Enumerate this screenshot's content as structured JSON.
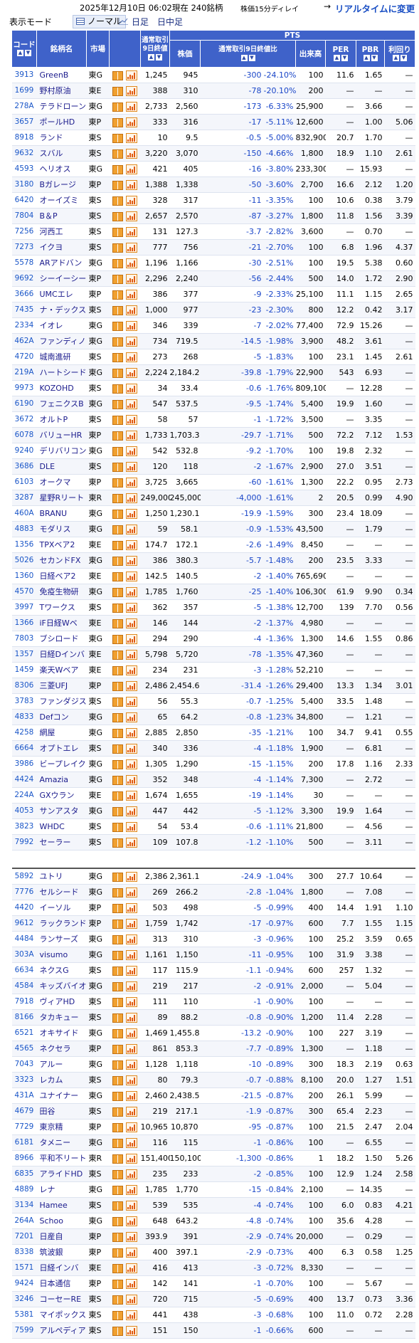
{
  "header": {
    "timestamp": "2025年12月10日  06:02現在  240銘柄",
    "delay_note": "株価15分ディレイ",
    "arrow": "→",
    "realtime_link": "リアルタイムに変更",
    "mode_label": "表示モード",
    "mode_normal": "ノーマル",
    "mode_day": "日足",
    "mode_day_mid": "日中足"
  },
  "table": {
    "headers": {
      "code": "コード",
      "name": "銘柄名",
      "market": "市場",
      "close_group": "通常取引9日終値",
      "pts": "PTS",
      "price": "株価",
      "change": "通常取引9日終値比",
      "volume": "出来高",
      "per": "PER",
      "pbr": "PBR",
      "yield": "利回り"
    },
    "rows": [
      [
        "3913",
        "GreenB",
        "東G",
        "1,245",
        "945",
        "-300",
        "-24.10%",
        "100",
        "11.6",
        "1.65",
        "—"
      ],
      [
        "1699",
        "野村原油",
        "東E",
        "388",
        "310",
        "-78",
        "-20.10%",
        "200",
        "—",
        "—",
        "—"
      ],
      [
        "278A",
        "テラドローン",
        "東G",
        "2,733",
        "2,560",
        "-173",
        "-6.33%",
        "25,900",
        "—",
        "3.66",
        "—"
      ],
      [
        "3657",
        "ポールHD",
        "東P",
        "333",
        "316",
        "-17",
        "-5.11%",
        "12,600",
        "—",
        "1.00",
        "5.06"
      ],
      [
        "8918",
        "ランド",
        "東S",
        "10",
        "9.5",
        "-0.5",
        "-5.00%",
        "832,900",
        "20.7",
        "1.70",
        "—"
      ],
      [
        "9632",
        "スバル",
        "東S",
        "3,220",
        "3,070",
        "-150",
        "-4.66%",
        "1,800",
        "18.9",
        "1.10",
        "2.61"
      ],
      [
        "4593",
        "ヘリオス",
        "東G",
        "421",
        "405",
        "-16",
        "-3.80%",
        "233,300",
        "—",
        "15.93",
        "—"
      ],
      [
        "3180",
        "Bガレージ",
        "東P",
        "1,388",
        "1,338",
        "-50",
        "-3.60%",
        "2,700",
        "16.6",
        "2.12",
        "1.20"
      ],
      [
        "6420",
        "オーイズミ",
        "東S",
        "328",
        "317",
        "-11",
        "-3.35%",
        "100",
        "10.6",
        "0.38",
        "3.79"
      ],
      [
        "7804",
        "B＆P",
        "東S",
        "2,657",
        "2,570",
        "-87",
        "-3.27%",
        "1,800",
        "11.8",
        "1.56",
        "3.39"
      ],
      [
        "7256",
        "河西工",
        "東S",
        "131",
        "127.3",
        "-3.7",
        "-2.82%",
        "3,600",
        "—",
        "0.70",
        "—"
      ],
      [
        "7273",
        "イクヨ",
        "東S",
        "777",
        "756",
        "-21",
        "-2.70%",
        "100",
        "6.8",
        "1.96",
        "4.37"
      ],
      [
        "5578",
        "ARアドバン",
        "東G",
        "1,196",
        "1,166",
        "-30",
        "-2.51%",
        "100",
        "19.5",
        "5.38",
        "0.60"
      ],
      [
        "9692",
        "シーイーシー",
        "東P",
        "2,296",
        "2,240",
        "-56",
        "-2.44%",
        "500",
        "14.0",
        "1.72",
        "2.90"
      ],
      [
        "3666",
        "UMCエレ",
        "東P",
        "386",
        "377",
        "-9",
        "-2.33%",
        "25,100",
        "11.1",
        "1.15",
        "2.65"
      ],
      [
        "7435",
        "ナ・デックス",
        "東S",
        "1,000",
        "977",
        "-23",
        "-2.30%",
        "800",
        "12.2",
        "0.42",
        "3.17"
      ],
      [
        "2334",
        "イオレ",
        "東G",
        "346",
        "339",
        "-7",
        "-2.02%",
        "77,400",
        "72.9",
        "15.26",
        "—"
      ],
      [
        "462A",
        "ファンディノ",
        "東G",
        "734",
        "719.5",
        "-14.5",
        "-1.98%",
        "3,900",
        "48.2",
        "3.61",
        "—"
      ],
      [
        "4720",
        "城南進研",
        "東S",
        "273",
        "268",
        "-5",
        "-1.83%",
        "100",
        "23.1",
        "1.45",
        "2.61"
      ],
      [
        "219A",
        "ハートシード",
        "東G",
        "2,224",
        "2,184.2",
        "-39.8",
        "-1.79%",
        "22,900",
        "543",
        "6.93",
        "—"
      ],
      [
        "9973",
        "KOZOHD",
        "東S",
        "34",
        "33.4",
        "-0.6",
        "-1.76%",
        "809,100",
        "—",
        "12.28",
        "—"
      ],
      [
        "6190",
        "フェニクスB",
        "東G",
        "547",
        "537.5",
        "-9.5",
        "-1.74%",
        "5,400",
        "19.9",
        "1.60",
        "—"
      ],
      [
        "3672",
        "オルトP",
        "東S",
        "58",
        "57",
        "-1",
        "-1.72%",
        "3,500",
        "—",
        "3.35",
        "—"
      ],
      [
        "6078",
        "バリューHR",
        "東P",
        "1,733",
        "1,703.3",
        "-29.7",
        "-1.71%",
        "500",
        "72.2",
        "7.12",
        "1.53"
      ],
      [
        "9240",
        "デリバリコン",
        "東G",
        "542",
        "532.8",
        "-9.2",
        "-1.70%",
        "100",
        "19.8",
        "2.32",
        "—"
      ],
      [
        "3686",
        "DLE",
        "東S",
        "120",
        "118",
        "-2",
        "-1.67%",
        "2,900",
        "27.0",
        "3.51",
        "—"
      ],
      [
        "6103",
        "オークマ",
        "東P",
        "3,725",
        "3,665",
        "-60",
        "-1.61%",
        "1,300",
        "22.2",
        "0.95",
        "2.73"
      ],
      [
        "3287",
        "星野Rリート",
        "東R",
        "249,000",
        "245,000",
        "-4,000",
        "-1.61%",
        "2",
        "20.5",
        "0.99",
        "4.90"
      ],
      [
        "460A",
        "BRANU",
        "東G",
        "1,250",
        "1,230.1",
        "-19.9",
        "-1.59%",
        "300",
        "23.4",
        "18.09",
        "—"
      ],
      [
        "4883",
        "モダリス",
        "東G",
        "59",
        "58.1",
        "-0.9",
        "-1.53%",
        "43,500",
        "—",
        "1.79",
        "—"
      ],
      [
        "1356",
        "TPXベア2",
        "東E",
        "174.7",
        "172.1",
        "-2.6",
        "-1.49%",
        "8,450",
        "—",
        "—",
        "—"
      ],
      [
        "5026",
        "セカンドFX",
        "東G",
        "386",
        "380.3",
        "-5.7",
        "-1.48%",
        "200",
        "23.5",
        "3.33",
        "—"
      ],
      [
        "1360",
        "日経ベア2",
        "東E",
        "142.5",
        "140.5",
        "-2",
        "-1.40%",
        "765,690",
        "—",
        "—",
        "—"
      ],
      [
        "4570",
        "免疫生物研",
        "東G",
        "1,785",
        "1,760",
        "-25",
        "-1.40%",
        "106,300",
        "61.9",
        "9.90",
        "0.34"
      ],
      [
        "3997",
        "Tワークス",
        "東S",
        "362",
        "357",
        "-5",
        "-1.38%",
        "12,700",
        "139",
        "7.70",
        "0.56"
      ],
      [
        "1366",
        "iF日経Wベ",
        "東E",
        "146",
        "144",
        "-2",
        "-1.37%",
        "4,980",
        "—",
        "—",
        "—"
      ],
      [
        "7803",
        "ブシロード",
        "東G",
        "294",
        "290",
        "-4",
        "-1.36%",
        "1,300",
        "14.6",
        "1.55",
        "0.86"
      ],
      [
        "1357",
        "日経Dインバ",
        "東E",
        "5,798",
        "5,720",
        "-78",
        "-1.35%",
        "47,360",
        "—",
        "—",
        "—"
      ],
      [
        "1459",
        "楽天Wベア",
        "東E",
        "234",
        "231",
        "-3",
        "-1.28%",
        "52,210",
        "—",
        "—",
        "—"
      ],
      [
        "8306",
        "三菱UFJ",
        "東P",
        "2,486",
        "2,454.6",
        "-31.4",
        "-1.26%",
        "29,400",
        "13.3",
        "1.34",
        "3.01"
      ],
      [
        "3783",
        "ファンダジス",
        "東S",
        "56",
        "55.3",
        "-0.7",
        "-1.25%",
        "5,400",
        "33.5",
        "1.48",
        "—"
      ],
      [
        "4833",
        "Defコン",
        "東G",
        "65",
        "64.2",
        "-0.8",
        "-1.23%",
        "34,800",
        "—",
        "1.21",
        "—"
      ],
      [
        "4258",
        "網屋",
        "東G",
        "2,885",
        "2,850",
        "-35",
        "-1.21%",
        "100",
        "34.7",
        "9.41",
        "0.55"
      ],
      [
        "6664",
        "オプトエレ",
        "東S",
        "340",
        "336",
        "-4",
        "-1.18%",
        "1,900",
        "—",
        "6.81",
        "—"
      ],
      [
        "3986",
        "ビープレイク",
        "東G",
        "1,305",
        "1,290",
        "-15",
        "-1.15%",
        "200",
        "17.8",
        "1.16",
        "2.33"
      ],
      [
        "4424",
        "Amazia",
        "東G",
        "352",
        "348",
        "-4",
        "-1.14%",
        "7,300",
        "—",
        "2.72",
        "—"
      ],
      [
        "224A",
        "GXウラン",
        "東E",
        "1,674",
        "1,655",
        "-19",
        "-1.14%",
        "30",
        "—",
        "—",
        "—"
      ],
      [
        "4053",
        "サンアスタ",
        "東G",
        "447",
        "442",
        "-5",
        "-1.12%",
        "3,300",
        "19.9",
        "1.64",
        "—"
      ],
      [
        "3823",
        "WHDC",
        "東S",
        "54",
        "53.4",
        "-0.6",
        "-1.11%",
        "21,800",
        "—",
        "4.56",
        "—"
      ],
      [
        "7992",
        "セーラー",
        "東S",
        "109",
        "107.8",
        "-1.2",
        "-1.10%",
        "500",
        "—",
        "3.11",
        "—"
      ]
    ],
    "rows2": [
      [
        "5892",
        "ユトリ",
        "東G",
        "2,386",
        "2,361.1",
        "-24.9",
        "-1.04%",
        "300",
        "27.7",
        "10.64",
        "—"
      ],
      [
        "7776",
        "セルシード",
        "東G",
        "269",
        "266.2",
        "-2.8",
        "-1.04%",
        "1,800",
        "—",
        "7.08",
        "—"
      ],
      [
        "4420",
        "イーソル",
        "東P",
        "503",
        "498",
        "-5",
        "-0.99%",
        "400",
        "14.4",
        "1.91",
        "1.10"
      ],
      [
        "9612",
        "ラックランド",
        "東P",
        "1,759",
        "1,742",
        "-17",
        "-0.97%",
        "600",
        "7.7",
        "1.55",
        "1.15"
      ],
      [
        "4484",
        "ランサーズ",
        "東G",
        "313",
        "310",
        "-3",
        "-0.96%",
        "100",
        "25.2",
        "3.59",
        "0.65"
      ],
      [
        "303A",
        "visumo",
        "東G",
        "1,161",
        "1,150",
        "-11",
        "-0.95%",
        "100",
        "31.9",
        "3.38",
        "—"
      ],
      [
        "6634",
        "ネクスG",
        "東S",
        "117",
        "115.9",
        "-1.1",
        "-0.94%",
        "600",
        "257",
        "1.32",
        "—"
      ],
      [
        "4584",
        "キッズバイオ",
        "東G",
        "219",
        "217",
        "-2",
        "-0.91%",
        "2,000",
        "—",
        "5.04",
        "—"
      ],
      [
        "7918",
        "ヴィアHD",
        "東S",
        "111",
        "110",
        "-1",
        "-0.90%",
        "100",
        "—",
        "—",
        "—"
      ],
      [
        "8166",
        "タカキュー",
        "東S",
        "89",
        "88.2",
        "-0.8",
        "-0.90%",
        "1,200",
        "11.4",
        "2.28",
        "—"
      ],
      [
        "6521",
        "オキサイド",
        "東G",
        "1,469",
        "1,455.8",
        "-13.2",
        "-0.90%",
        "100",
        "227",
        "3.19",
        "—"
      ],
      [
        "4565",
        "ネクセラ",
        "東P",
        "861",
        "853.3",
        "-7.7",
        "-0.89%",
        "1,300",
        "—",
        "1.18",
        "—"
      ],
      [
        "7043",
        "アルー",
        "東G",
        "1,128",
        "1,118",
        "-10",
        "-0.89%",
        "300",
        "18.3",
        "2.19",
        "0.63"
      ],
      [
        "3323",
        "レカム",
        "東S",
        "80",
        "79.3",
        "-0.7",
        "-0.88%",
        "8,100",
        "20.0",
        "1.27",
        "1.51"
      ],
      [
        "431A",
        "ユナイナー",
        "東G",
        "2,460",
        "2,438.5",
        "-21.5",
        "-0.87%",
        "200",
        "26.1",
        "5.99",
        "—"
      ],
      [
        "4679",
        "田谷",
        "東S",
        "219",
        "217.1",
        "-1.9",
        "-0.87%",
        "300",
        "65.4",
        "2.23",
        "—"
      ],
      [
        "7729",
        "東京精",
        "東P",
        "10,965",
        "10,870",
        "-95",
        "-0.87%",
        "100",
        "21.5",
        "2.47",
        "2.04"
      ],
      [
        "6181",
        "タメニー",
        "東G",
        "116",
        "115",
        "-1",
        "-0.86%",
        "100",
        "—",
        "6.55",
        "—"
      ],
      [
        "8966",
        "平和不リート",
        "東R",
        "151,400",
        "150,100",
        "-1,300",
        "-0.86%",
        "1",
        "18.2",
        "1.50",
        "5.26"
      ],
      [
        "6835",
        "アライドHD",
        "東S",
        "235",
        "233",
        "-2",
        "-0.85%",
        "100",
        "12.9",
        "1.24",
        "2.58"
      ],
      [
        "4889",
        "レナ",
        "東G",
        "1,785",
        "1,770",
        "-15",
        "-0.84%",
        "2,100",
        "—",
        "14.35",
        "—"
      ],
      [
        "3134",
        "Hamee",
        "東S",
        "539",
        "535",
        "-4",
        "-0.74%",
        "100",
        "6.0",
        "0.83",
        "4.21"
      ],
      [
        "264A",
        "Schoo",
        "東G",
        "648",
        "643.2",
        "-4.8",
        "-0.74%",
        "100",
        "35.6",
        "4.28",
        "—"
      ],
      [
        "7201",
        "日産自",
        "東P",
        "393.9",
        "391",
        "-2.9",
        "-0.74%",
        "20,000",
        "—",
        "0.29",
        "—"
      ],
      [
        "8338",
        "筑波銀",
        "東P",
        "400",
        "397.1",
        "-2.9",
        "-0.73%",
        "400",
        "6.3",
        "0.58",
        "1.25"
      ],
      [
        "1571",
        "日経インバ",
        "東E",
        "416",
        "413",
        "-3",
        "-0.72%",
        "8,330",
        "—",
        "—",
        "—"
      ],
      [
        "9424",
        "日本通信",
        "東P",
        "142",
        "141",
        "-1",
        "-0.70%",
        "100",
        "—",
        "5.67",
        "—"
      ],
      [
        "3246",
        "コーセーRE",
        "東S",
        "720",
        "715",
        "-5",
        "-0.69%",
        "400",
        "13.7",
        "0.73",
        "3.36"
      ],
      [
        "5381",
        "マイポックス",
        "東S",
        "441",
        "438",
        "-3",
        "-0.68%",
        "100",
        "11.0",
        "0.72",
        "2.28"
      ],
      [
        "7599",
        "アルペディア",
        "東S",
        "151",
        "150",
        "-1",
        "-0.66%",
        "600",
        "—",
        "—",
        "—"
      ]
    ]
  }
}
